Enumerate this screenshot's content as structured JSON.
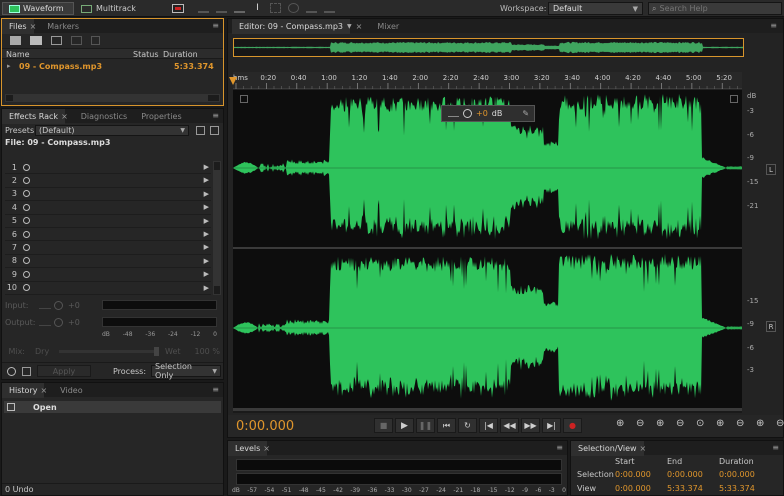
{
  "toolbar": {
    "waveform_label": "Waveform",
    "multitrack_label": "Multitrack",
    "workspace_label": "Workspace:",
    "workspace_value": "Default",
    "search_placeholder": "Search Help"
  },
  "files_panel": {
    "tabs": [
      "Files",
      "Markers"
    ],
    "columns": {
      "name": "Name",
      "status": "Status",
      "duration": "Duration"
    },
    "file": {
      "name": "09 - Compass.mp3",
      "duration": "5:33.374"
    }
  },
  "effects_rack": {
    "tabs": [
      "Effects Rack",
      "Diagnostics",
      "Properties"
    ],
    "presets_label": "Presets:",
    "presets_value": "(Default)",
    "file_label": "File: 09 - Compass.mp3",
    "slots": [
      "1",
      "2",
      "3",
      "4",
      "5",
      "6",
      "7",
      "8",
      "9",
      "10"
    ],
    "input_label": "Input:",
    "output_label": "Output:",
    "input_db": "+0",
    "output_db": "+0",
    "meter_scale": [
      "dB",
      "-48",
      "-36",
      "-24",
      "-12",
      "0"
    ],
    "mix_label": "Mix:",
    "dry_label": "Dry",
    "wet_label": "Wet",
    "mix_value": "100 %",
    "apply_label": "Apply",
    "process_label": "Process:",
    "process_value": "Selection Only"
  },
  "history_panel": {
    "tabs": [
      "History",
      "Video"
    ],
    "item": "Open",
    "undo_count": "0 Undo"
  },
  "editor": {
    "tabs": [
      "Editor: 09 - Compass.mp3",
      "Mixer"
    ],
    "time_marks": [
      "hms",
      "0:20",
      "0:40",
      "1:00",
      "1:20",
      "1:40",
      "2:00",
      "2:20",
      "2:40",
      "3:00",
      "3:20",
      "3:40",
      "4:00",
      "4:20",
      "4:40",
      "5:00",
      "5:20"
    ],
    "db_scale": [
      "dB",
      "-3",
      "-6",
      "-9",
      "-15",
      "-21",
      "-15",
      "-9",
      "-6",
      "-3"
    ],
    "channel_top": "L",
    "channel_bottom": "R",
    "hud_value": "+0",
    "hud_unit": "dB",
    "current_time": "0:00.000"
  },
  "levels_panel": {
    "tab": "Levels",
    "scale": [
      "dB",
      "-57",
      "-54",
      "-51",
      "-48",
      "-45",
      "-42",
      "-39",
      "-36",
      "-33",
      "-30",
      "-27",
      "-24",
      "-21",
      "-18",
      "-15",
      "-12",
      "-9",
      "-6",
      "-3",
      "0"
    ]
  },
  "selection_view": {
    "tab": "Selection/View",
    "headers": {
      "start": "Start",
      "end": "End",
      "duration": "Duration"
    },
    "rows": [
      {
        "label": "Selection",
        "start": "0:00.000",
        "end": "0:00.000",
        "duration": "0:00.000"
      },
      {
        "label": "View",
        "start": "0:00.000",
        "end": "5:33.374",
        "duration": "5:33.374"
      }
    ]
  },
  "colors": {
    "waveform": "#2ec35c",
    "accent": "#e0962c",
    "background": "#1a1a1a"
  }
}
